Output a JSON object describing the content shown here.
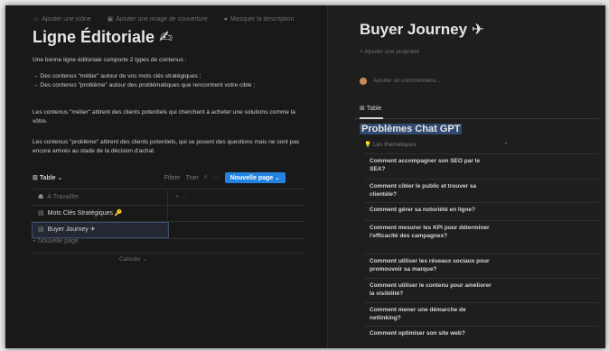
{
  "left": {
    "topbar": {
      "add_icon": "Ajouter une icône",
      "add_cover": "Ajouter une image de couverture",
      "hide_desc": "Masquer la description"
    },
    "title": "Ligne Éditoriale ✍",
    "intro": "Une bonne ligne éditoriale comporte 2 types de contenus :",
    "bullet1": "→ Des contenus \"métier\" autour de vos mots clés stratégiques ;",
    "bullet2": "→ Des contenus \"problème\" autour des problématiques que rencontrent votre cible ;",
    "para1": "Les contenus \"métier\" attirent des clients potentiels qui cherchent à acheter une solutions comme la vôtre.",
    "para2": "Les contenus \"problème\" attirent des clients potentiels, qui se posent des questions mais ne sont pas encore arrivés au stade de la décision d'achat.",
    "table": {
      "label": "Table ⌄",
      "filter": "Filtrer",
      "sort": "Trier",
      "new_page": "Nouvelle page",
      "rows": [
        {
          "label": "À Travailler"
        },
        {
          "label": "Mots Clés Stratégiques 🔑"
        },
        {
          "label": "Buyer Journey ✈"
        }
      ],
      "add_row": "+ Nouvelle page",
      "calc": "Calculer ⌄"
    }
  },
  "right": {
    "title": "Buyer Journey ✈",
    "add_prop": "+  Ajouter une propriété",
    "add_comment": "Ajouter un commentaire...",
    "tab_label": "Table",
    "group_title": "Problèmes Chat GPT",
    "col_header": "Les thématiques",
    "themes": [
      "Comment accompagner son SEO par le SEA?",
      "Comment cibler le public et trouver sa clientèle?",
      "Comment gérer sa notoriété en ligne?",
      "Comment mesurer les KPI pour déterminer l'efficacité des campagnes?",
      "Comment utiliser les réseaux sociaux pour promouvoir sa marque?",
      "Comment utiliser le contenu pour améliorer la visibilité?",
      "Comment mener une démarche de netlinking?",
      "Comment optimiser son site web?"
    ]
  }
}
